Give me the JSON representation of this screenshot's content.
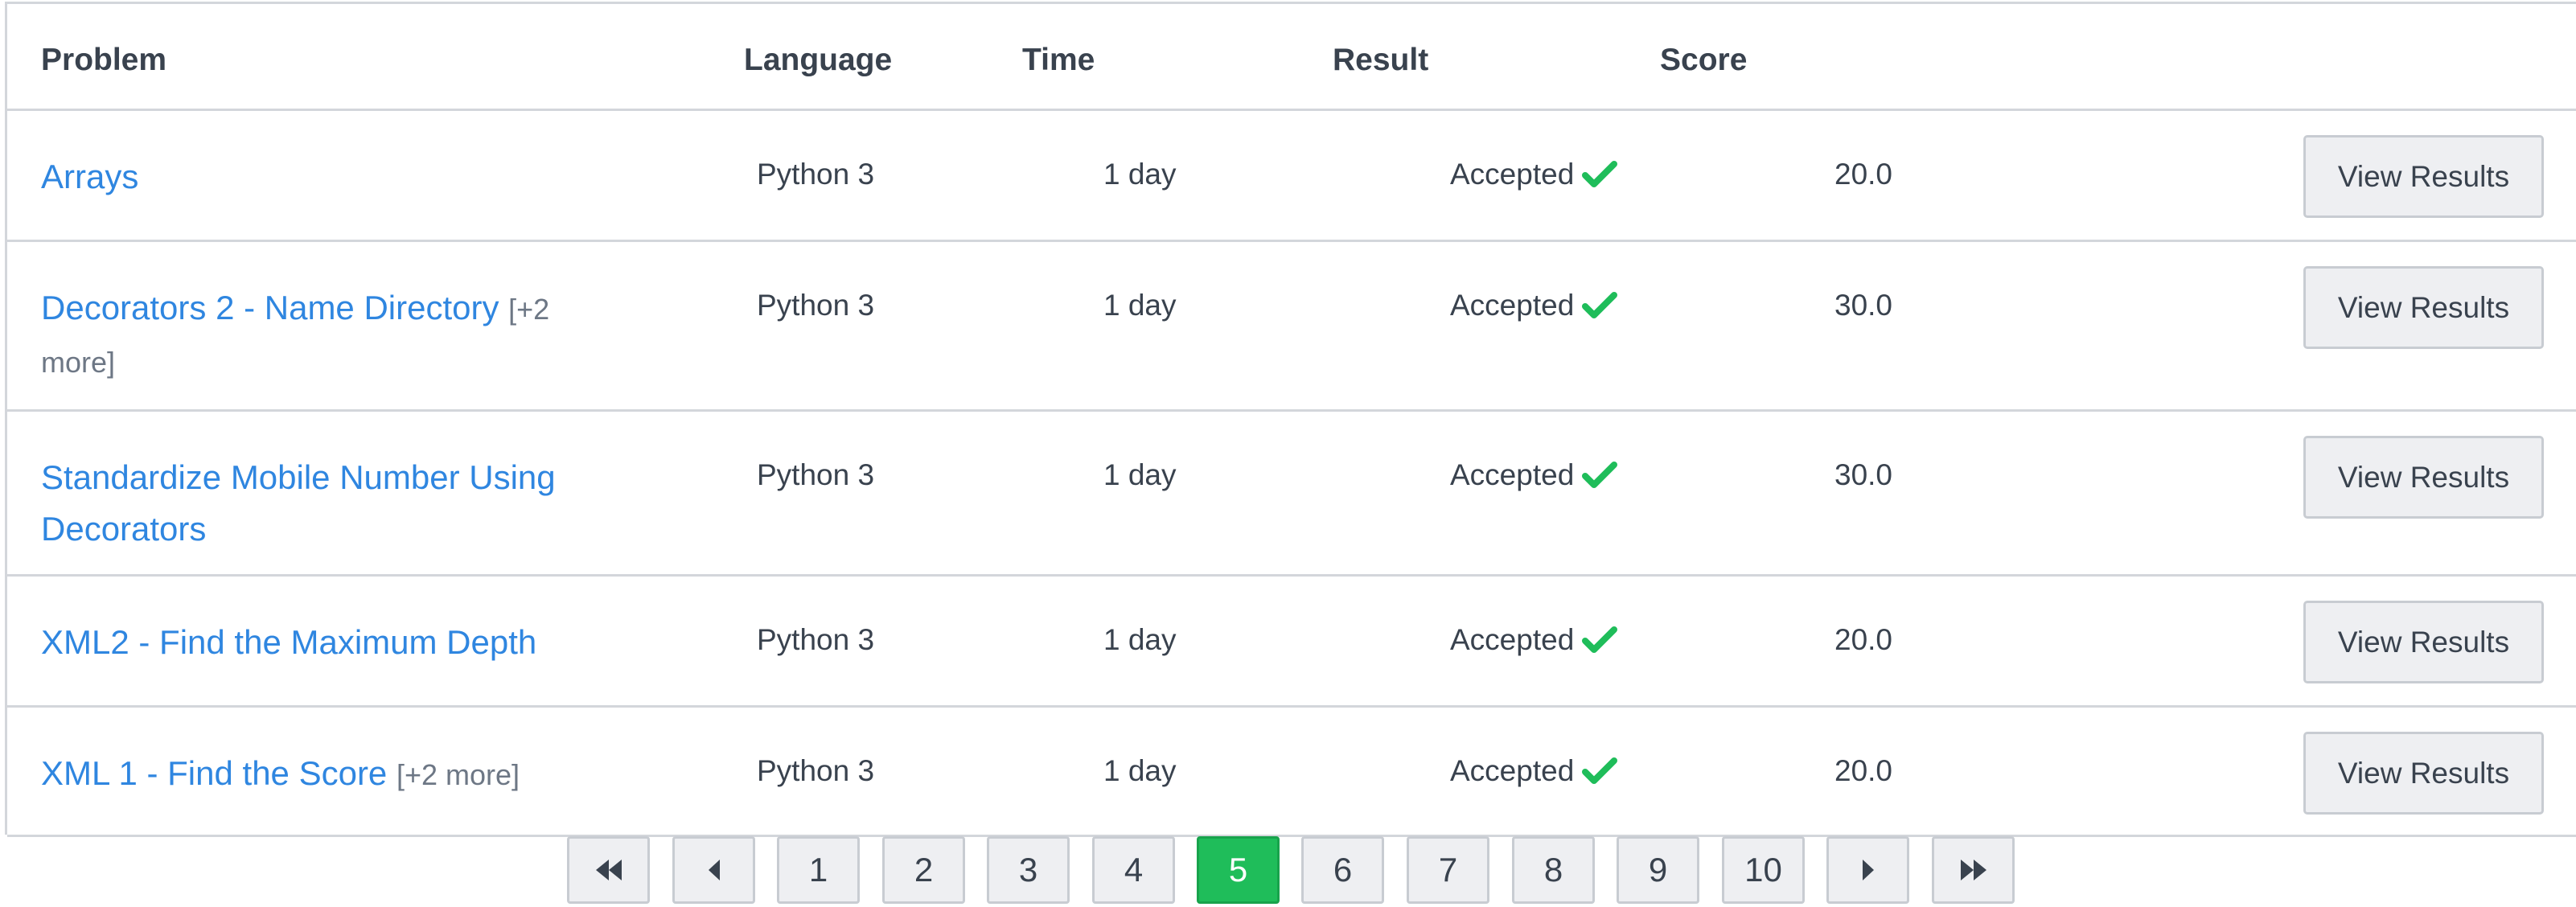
{
  "table": {
    "headers": {
      "problem": "Problem",
      "language": "Language",
      "time": "Time",
      "result": "Result",
      "score": "Score"
    },
    "rows": [
      {
        "problem": "Arrays",
        "more": "",
        "language": "Python 3",
        "time": "1 day",
        "result": "Accepted",
        "score": "20.0",
        "action": "View Results"
      },
      {
        "problem": "Decorators 2 - Name Directory",
        "more": "[+2 more]",
        "language": "Python 3",
        "time": "1 day",
        "result": "Accepted",
        "score": "30.0",
        "action": "View Results"
      },
      {
        "problem": "Standardize Mobile Number Using Decorators",
        "more": "",
        "language": "Python 3",
        "time": "1 day",
        "result": "Accepted",
        "score": "30.0",
        "action": "View Results"
      },
      {
        "problem": "XML2 - Find the Maximum Depth",
        "more": "",
        "language": "Python 3",
        "time": "1 day",
        "result": "Accepted",
        "score": "20.0",
        "action": "View Results"
      },
      {
        "problem": "XML 1 - Find the Score",
        "more": "[+2 more]",
        "language": "Python 3",
        "time": "1 day",
        "result": "Accepted",
        "score": "20.0",
        "action": "View Results"
      }
    ]
  },
  "pagination": {
    "pages": [
      "1",
      "2",
      "3",
      "4",
      "5",
      "6",
      "7",
      "8",
      "9",
      "10"
    ],
    "current_page": "5",
    "icons": {
      "first": "double-chevron-left-icon",
      "prev": "caret-left-icon",
      "next": "caret-right-icon",
      "last": "double-chevron-right-icon"
    }
  },
  "colors": {
    "link": "#2f86e0",
    "accepted_check": "#1fbd5a",
    "active_page": "#1fbd5a",
    "border": "#d3d6db",
    "button_bg": "#eeeff2"
  }
}
